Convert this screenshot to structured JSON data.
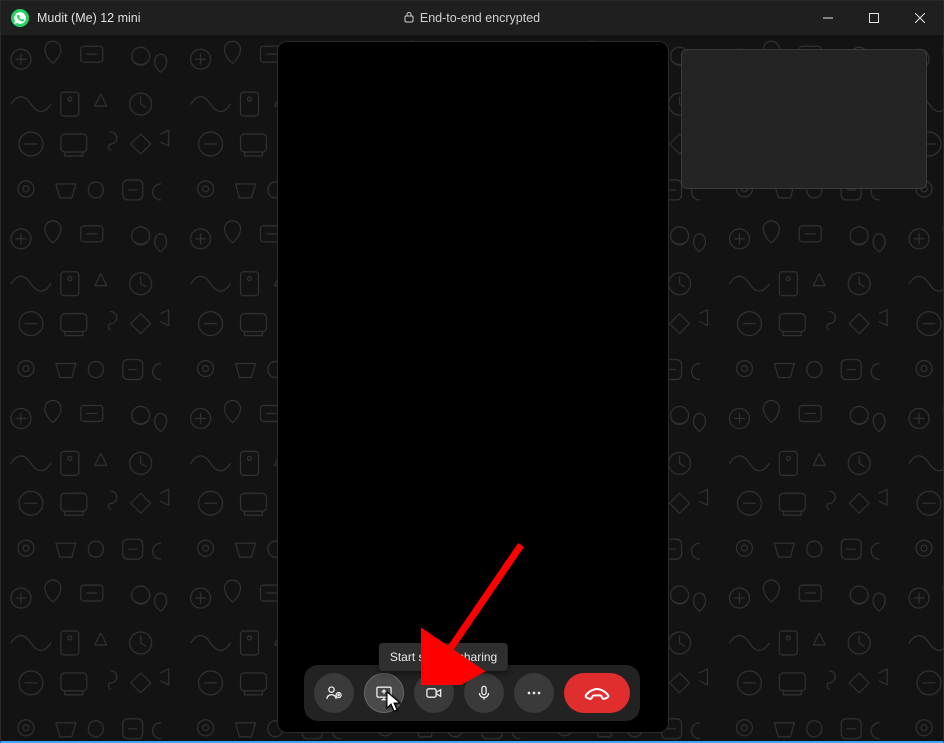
{
  "titlebar": {
    "title": "Mudit (Me) 12 mini",
    "encryption_label": "End-to-end encrypted"
  },
  "tooltip": {
    "screen_share": "Start screen sharing"
  },
  "controls": {
    "add_participant": "add-participant",
    "screen_share": "screen-share",
    "video": "video",
    "mic": "mic",
    "more": "more",
    "end_call": "end-call"
  },
  "colors": {
    "brand_green": "#25d366",
    "end_call_red": "#e02d2d",
    "annotation_red": "#ff0000"
  }
}
